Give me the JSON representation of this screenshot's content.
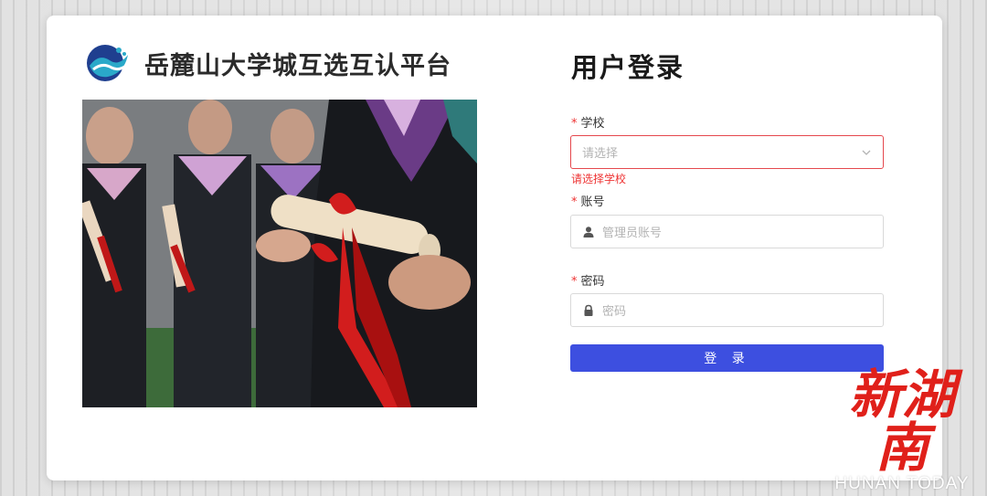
{
  "brand": {
    "title": "岳麓山大学城互选互认平台",
    "logo_icon": "wave-logo-icon"
  },
  "login": {
    "title": "用户登录",
    "school": {
      "required_mark": "*",
      "label": "学校",
      "placeholder": "请选择",
      "error": "请选择学校"
    },
    "account": {
      "required_mark": "*",
      "label": "账号",
      "placeholder": "管理员账号",
      "icon": "user-icon"
    },
    "password": {
      "required_mark": "*",
      "label": "密码",
      "placeholder": "密码",
      "icon": "lock-icon"
    },
    "submit_label": "登 录"
  },
  "watermark": {
    "cn": "新湖南",
    "en": "HUNAN TODAY"
  },
  "colors": {
    "primary": "#3d4fe0",
    "error": "#e5484d",
    "watermark_red": "#e0201a"
  }
}
